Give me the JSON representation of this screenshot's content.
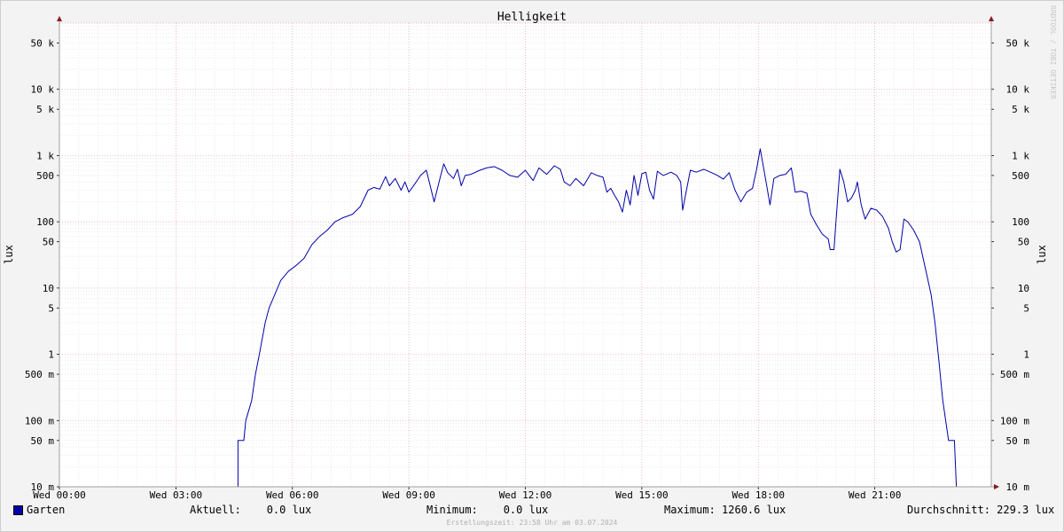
{
  "chart_data": {
    "type": "line",
    "title": "Helligkeit",
    "ylabel_left": "lux",
    "ylabel_right": "lux",
    "y_scale": "log",
    "ylim": [
      0.01,
      100000
    ],
    "y_ticks": [
      {
        "value": 50000,
        "label": "50 k"
      },
      {
        "value": 10000,
        "label": "10 k"
      },
      {
        "value": 5000,
        "label": "5 k"
      },
      {
        "value": 1000,
        "label": "1 k"
      },
      {
        "value": 500,
        "label": "500"
      },
      {
        "value": 100,
        "label": "100"
      },
      {
        "value": 50,
        "label": "50"
      },
      {
        "value": 10,
        "label": "10"
      },
      {
        "value": 5,
        "label": "5"
      },
      {
        "value": 1,
        "label": "1"
      },
      {
        "value": 0.5,
        "label": "500 m"
      },
      {
        "value": 0.1,
        "label": "100 m"
      },
      {
        "value": 0.05,
        "label": "50 m"
      },
      {
        "value": 0.01,
        "label": "10 m"
      }
    ],
    "x_unit": "hours",
    "xlim": [
      0,
      24
    ],
    "x_ticks": [
      {
        "value": 0,
        "label": "Wed 00:00"
      },
      {
        "value": 3,
        "label": "Wed 03:00"
      },
      {
        "value": 6,
        "label": "Wed 06:00"
      },
      {
        "value": 9,
        "label": "Wed 09:00"
      },
      {
        "value": 12,
        "label": "Wed 12:00"
      },
      {
        "value": 15,
        "label": "Wed 15:00"
      },
      {
        "value": 18,
        "label": "Wed 18:00"
      },
      {
        "value": 21,
        "label": "Wed 21:00"
      }
    ],
    "grid": true,
    "series": [
      {
        "name": "Garten",
        "color": "#0000aa",
        "points": [
          [
            0.0,
            0.01
          ],
          [
            4.6,
            0.01
          ],
          [
            4.6,
            0.05
          ],
          [
            4.75,
            0.05
          ],
          [
            4.8,
            0.1
          ],
          [
            4.95,
            0.2
          ],
          [
            5.05,
            0.5
          ],
          [
            5.15,
            1
          ],
          [
            5.3,
            3
          ],
          [
            5.4,
            5
          ],
          [
            5.55,
            8
          ],
          [
            5.7,
            13
          ],
          [
            5.9,
            18
          ],
          [
            6.1,
            22
          ],
          [
            6.3,
            28
          ],
          [
            6.5,
            45
          ],
          [
            6.7,
            60
          ],
          [
            6.9,
            75
          ],
          [
            7.1,
            100
          ],
          [
            7.3,
            115
          ],
          [
            7.55,
            130
          ],
          [
            7.75,
            170
          ],
          [
            7.95,
            300
          ],
          [
            8.1,
            330
          ],
          [
            8.25,
            310
          ],
          [
            8.4,
            480
          ],
          [
            8.5,
            350
          ],
          [
            8.65,
            450
          ],
          [
            8.8,
            300
          ],
          [
            8.9,
            400
          ],
          [
            9.0,
            280
          ],
          [
            9.15,
            370
          ],
          [
            9.3,
            500
          ],
          [
            9.45,
            600
          ],
          [
            9.55,
            350
          ],
          [
            9.65,
            200
          ],
          [
            9.8,
            450
          ],
          [
            9.9,
            750
          ],
          [
            10.0,
            550
          ],
          [
            10.15,
            450
          ],
          [
            10.25,
            620
          ],
          [
            10.35,
            350
          ],
          [
            10.45,
            500
          ],
          [
            10.6,
            520
          ],
          [
            10.8,
            590
          ],
          [
            11.0,
            650
          ],
          [
            11.2,
            680
          ],
          [
            11.4,
            600
          ],
          [
            11.6,
            500
          ],
          [
            11.8,
            470
          ],
          [
            12.0,
            600
          ],
          [
            12.1,
            500
          ],
          [
            12.2,
            420
          ],
          [
            12.35,
            650
          ],
          [
            12.55,
            520
          ],
          [
            12.75,
            700
          ],
          [
            12.9,
            620
          ],
          [
            13.0,
            400
          ],
          [
            13.15,
            350
          ],
          [
            13.3,
            450
          ],
          [
            13.5,
            350
          ],
          [
            13.7,
            550
          ],
          [
            13.85,
            500
          ],
          [
            14.0,
            470
          ],
          [
            14.1,
            280
          ],
          [
            14.2,
            320
          ],
          [
            14.3,
            250
          ],
          [
            14.4,
            200
          ],
          [
            14.5,
            140
          ],
          [
            14.6,
            300
          ],
          [
            14.7,
            180
          ],
          [
            14.8,
            500
          ],
          [
            14.9,
            250
          ],
          [
            15.0,
            530
          ],
          [
            15.1,
            560
          ],
          [
            15.2,
            300
          ],
          [
            15.3,
            220
          ],
          [
            15.4,
            580
          ],
          [
            15.55,
            500
          ],
          [
            15.75,
            560
          ],
          [
            15.9,
            500
          ],
          [
            16.0,
            400
          ],
          [
            16.05,
            150
          ],
          [
            16.15,
            300
          ],
          [
            16.25,
            600
          ],
          [
            16.4,
            560
          ],
          [
            16.6,
            620
          ],
          [
            16.8,
            550
          ],
          [
            16.95,
            500
          ],
          [
            17.1,
            440
          ],
          [
            17.25,
            550
          ],
          [
            17.4,
            300
          ],
          [
            17.55,
            200
          ],
          [
            17.7,
            280
          ],
          [
            17.85,
            320
          ],
          [
            17.95,
            600
          ],
          [
            18.05,
            1260
          ],
          [
            18.2,
            400
          ],
          [
            18.3,
            180
          ],
          [
            18.4,
            450
          ],
          [
            18.55,
            500
          ],
          [
            18.7,
            520
          ],
          [
            18.85,
            650
          ],
          [
            18.95,
            280
          ],
          [
            19.1,
            290
          ],
          [
            19.25,
            270
          ],
          [
            19.35,
            130
          ],
          [
            19.5,
            90
          ],
          [
            19.65,
            65
          ],
          [
            19.8,
            55
          ],
          [
            19.85,
            38
          ],
          [
            19.95,
            38
          ],
          [
            20.0,
            100
          ],
          [
            20.1,
            620
          ],
          [
            20.2,
            400
          ],
          [
            20.3,
            200
          ],
          [
            20.4,
            230
          ],
          [
            20.5,
            300
          ],
          [
            20.55,
            400
          ],
          [
            20.65,
            180
          ],
          [
            20.75,
            110
          ],
          [
            20.9,
            160
          ],
          [
            21.05,
            150
          ],
          [
            21.2,
            120
          ],
          [
            21.35,
            80
          ],
          [
            21.45,
            50
          ],
          [
            21.55,
            35
          ],
          [
            21.65,
            38
          ],
          [
            21.75,
            110
          ],
          [
            21.85,
            100
          ],
          [
            22.0,
            75
          ],
          [
            22.15,
            50
          ],
          [
            22.3,
            20
          ],
          [
            22.45,
            8
          ],
          [
            22.55,
            3
          ],
          [
            22.65,
            0.8
          ],
          [
            22.75,
            0.2
          ],
          [
            22.85,
            0.08
          ],
          [
            22.9,
            0.05
          ],
          [
            23.05,
            0.05
          ],
          [
            23.1,
            0.01
          ],
          [
            24.0,
            0.01
          ]
        ]
      }
    ]
  },
  "legend": {
    "series_name": "Garten",
    "current": "Aktuell:    0.0 lux",
    "minimum": "Minimum:    0.0 lux",
    "maximum": "Maximum: 1260.6 lux",
    "average": "Durchschnitt: 229.3 lux"
  },
  "footer": "Erstellungszeit: 23:58 Uhr am 03.07.2024",
  "watermark": "RRDTOOL / TOBI OETIKER"
}
